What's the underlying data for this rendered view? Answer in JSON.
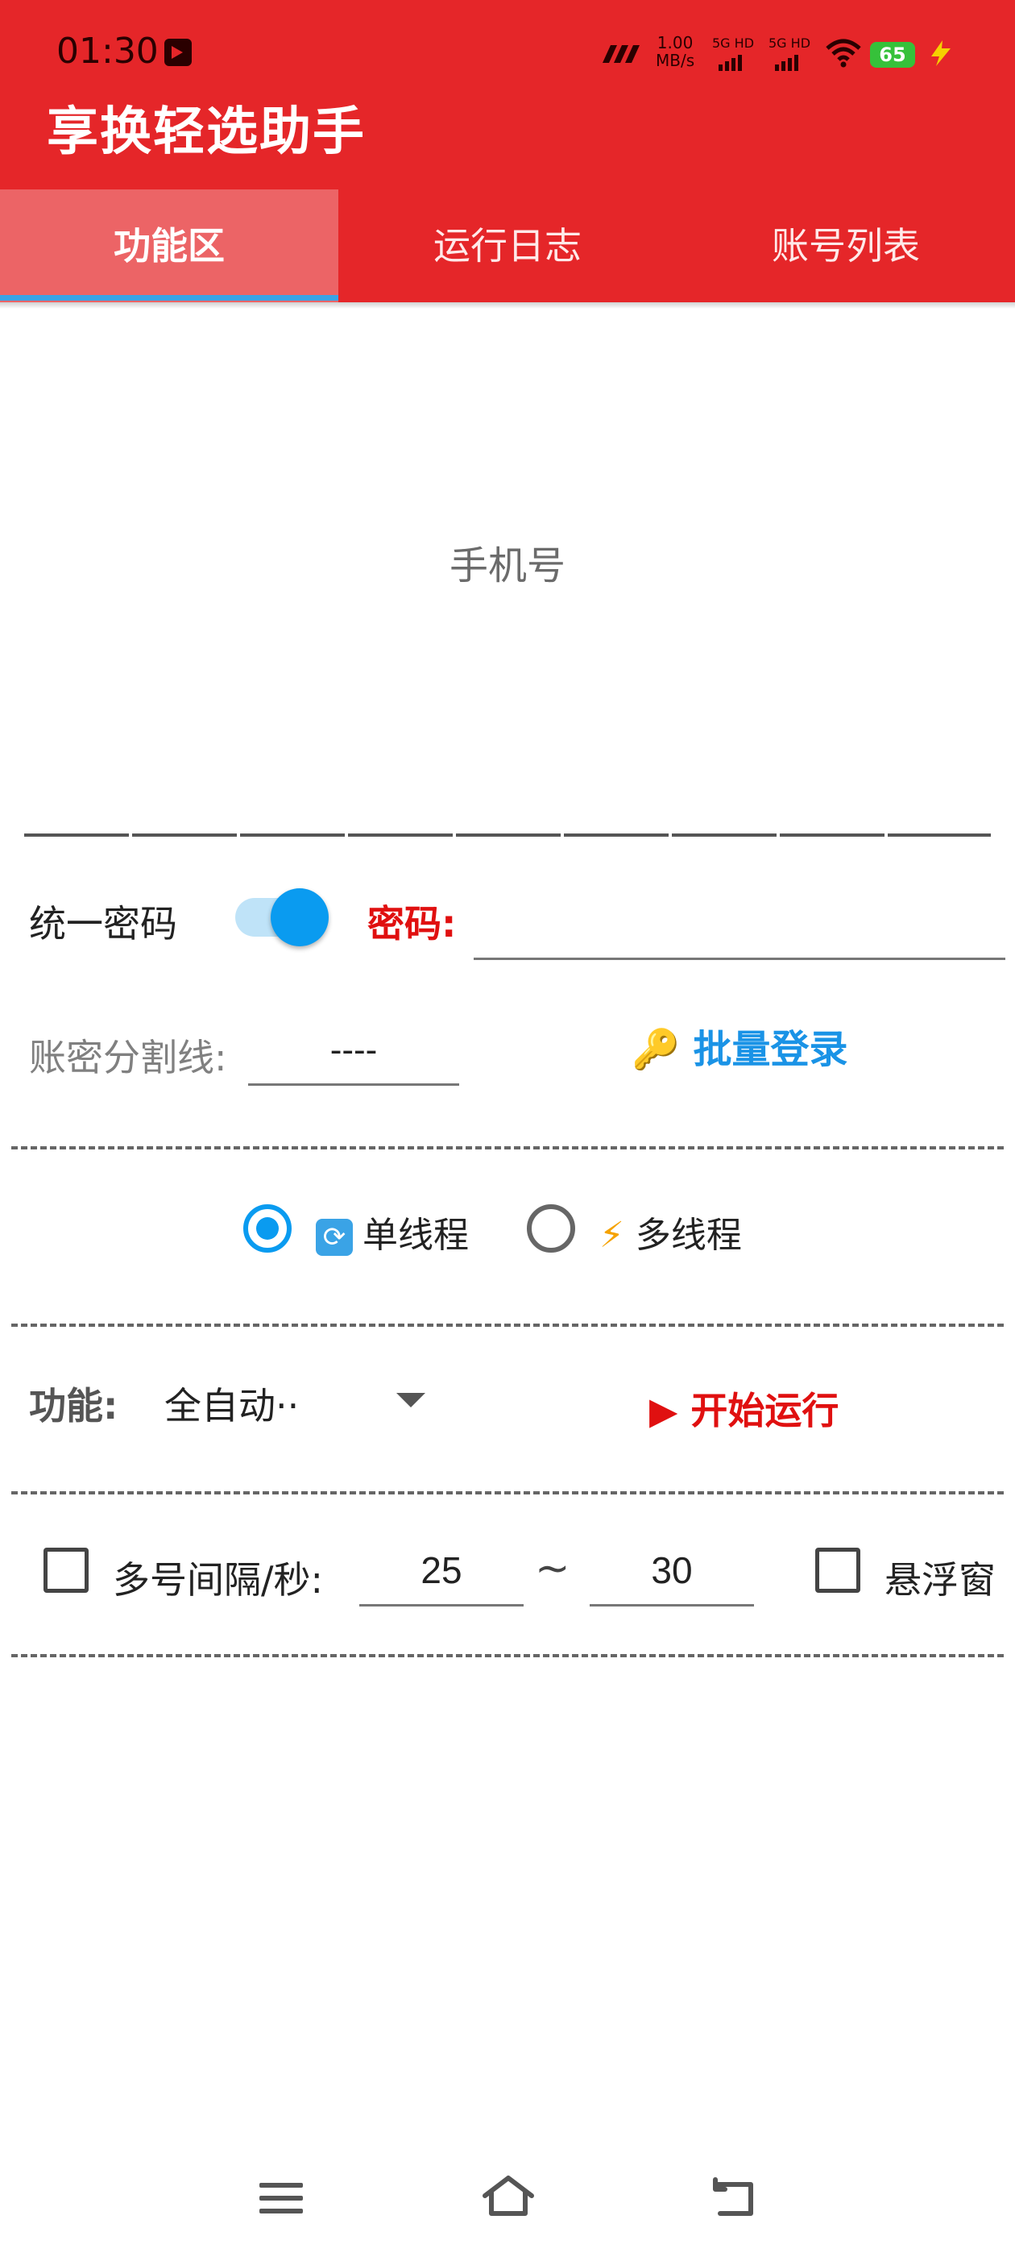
{
  "status_bar": {
    "time": "01:30",
    "speed_value": "1.00",
    "speed_unit": "MB/s",
    "sim1": "5G HD",
    "sim2": "5G HD",
    "battery": "65"
  },
  "app": {
    "title": "享换轻选助手"
  },
  "tabs": [
    {
      "label": "功能区",
      "active": true
    },
    {
      "label": "运行日志",
      "active": false
    },
    {
      "label": "账号列表",
      "active": false
    }
  ],
  "phone_input": {
    "placeholder": "手机号",
    "value": ""
  },
  "password_row": {
    "unified_label": "统一密码",
    "unified_enabled": true,
    "password_label": "密码:",
    "password_value": ""
  },
  "separator_row": {
    "label": "账密分割线:",
    "value": "----",
    "batch_login_label": "🔑 批量登录"
  },
  "thread_mode": {
    "single_label": "单线程",
    "multi_label": "多线程",
    "selected": "single"
  },
  "function_row": {
    "label": "功能:",
    "selected_value": "全自动··",
    "start_label": "▶ 开始运行"
  },
  "interval_row": {
    "interval_checked": false,
    "interval_label": "多号间隔/秒:",
    "min_value": "25",
    "tilde": "~",
    "max_value": "30",
    "float_checked": false,
    "float_label": "悬浮窗"
  },
  "colors": {
    "header_bg": "#E52629",
    "active_tab_bg": "#EC6466",
    "accent_blue": "#0a9bf0",
    "danger_red": "#e01010"
  },
  "icons": {
    "nav_menu": "menu-icon",
    "nav_home": "home-icon",
    "nav_back": "back-icon"
  }
}
